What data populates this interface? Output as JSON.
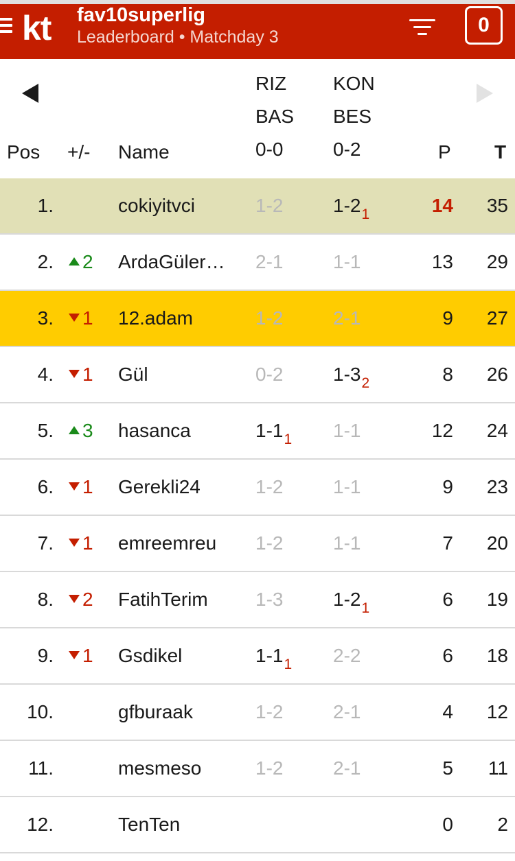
{
  "header": {
    "logo": "kt",
    "title": "fav10superlig",
    "subtitle": "Leaderboard • Matchday 3",
    "counter": "0",
    "icons": [
      "menu-icon",
      "filter-icon"
    ],
    "accent": "#c41e00"
  },
  "columns": {
    "pos": "Pos",
    "change": "+/-",
    "name": "Name",
    "points": "P",
    "total": "T"
  },
  "matches": [
    {
      "home": "RIZ",
      "away": "BAS",
      "score": "0-0"
    },
    {
      "home": "KON",
      "away": "BES",
      "score": "0-2"
    }
  ],
  "rows": [
    {
      "pos": "1.",
      "change": "",
      "name": "cokiyitvci",
      "m1": "1-2",
      "m1_pts": "",
      "m2": "1-2",
      "m2_pts": "1",
      "p": "14",
      "t": "35"
    },
    {
      "pos": "2.",
      "change": "2",
      "name": "ArdaGüler…",
      "m1": "2-1",
      "m1_pts": "",
      "m2": "1-1",
      "m2_pts": "",
      "p": "13",
      "t": "29"
    },
    {
      "pos": "3.",
      "change": "1",
      "name": "12.adam",
      "m1": "1-2",
      "m1_pts": "",
      "m2": "2-1",
      "m2_pts": "",
      "p": "9",
      "t": "27"
    },
    {
      "pos": "4.",
      "change": "1",
      "name": "Gül",
      "m1": "0-2",
      "m1_pts": "",
      "m2": "1-3",
      "m2_pts": "2",
      "p": "8",
      "t": "26"
    },
    {
      "pos": "5.",
      "change": "3",
      "name": "hasanca",
      "m1": "1-1",
      "m1_pts": "1",
      "m2": "1-1",
      "m2_pts": "",
      "p": "12",
      "t": "24"
    },
    {
      "pos": "6.",
      "change": "1",
      "name": "Gerekli24",
      "m1": "1-2",
      "m1_pts": "",
      "m2": "1-1",
      "m2_pts": "",
      "p": "9",
      "t": "23"
    },
    {
      "pos": "7.",
      "change": "1",
      "name": "emreemreu",
      "m1": "1-2",
      "m1_pts": "",
      "m2": "1-1",
      "m2_pts": "",
      "p": "7",
      "t": "20"
    },
    {
      "pos": "8.",
      "change": "2",
      "name": "FatihTerim",
      "m1": "1-3",
      "m1_pts": "",
      "m2": "1-2",
      "m2_pts": "1",
      "p": "6",
      "t": "19"
    },
    {
      "pos": "9.",
      "change": "1",
      "name": "Gsdikel",
      "m1": "1-1",
      "m1_pts": "1",
      "m2": "2-2",
      "m2_pts": "",
      "p": "6",
      "t": "18"
    },
    {
      "pos": "10.",
      "change": "",
      "name": "gfburaak",
      "m1": "1-2",
      "m1_pts": "",
      "m2": "2-1",
      "m2_pts": "",
      "p": "4",
      "t": "12"
    },
    {
      "pos": "11.",
      "change": "",
      "name": "mesmeso",
      "m1": "1-2",
      "m1_pts": "",
      "m2": "2-1",
      "m2_pts": "",
      "p": "5",
      "t": "11"
    },
    {
      "pos": "12.",
      "change": "",
      "name": "TenTen",
      "m1": "",
      "m1_pts": "",
      "m2": "",
      "m2_pts": "",
      "p": "0",
      "t": "2"
    }
  ]
}
